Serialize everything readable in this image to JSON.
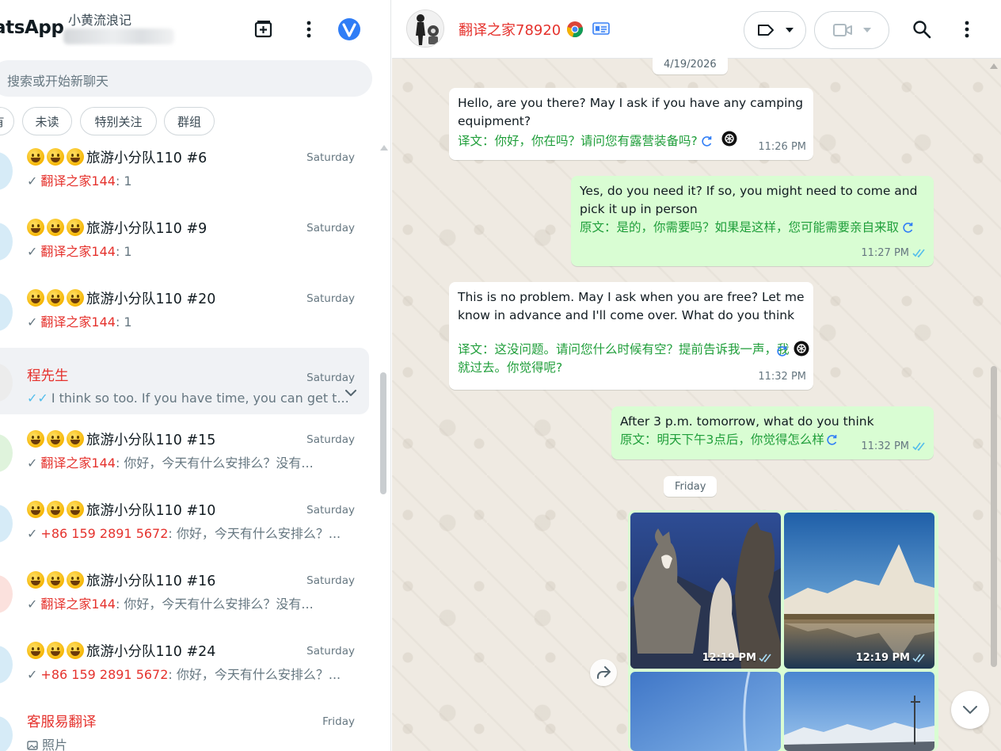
{
  "app": {
    "brand": "atsApp",
    "account_name": "小黄流浪记"
  },
  "search": {
    "placeholder": "搜索或开始新聊天"
  },
  "filters": [
    "有",
    "未读",
    "特别关注",
    "群组"
  ],
  "chats": [
    {
      "name": "旅游小分队110 #6",
      "emoji_prefix": 3,
      "time": "Saturday",
      "tick": "✓",
      "sender": "翻译之家144",
      "preview": ": 1",
      "avatar_color": "#d6ebf7"
    },
    {
      "name": "旅游小分队110 #9",
      "emoji_prefix": 3,
      "time": "Saturday",
      "tick": "✓",
      "sender": "翻译之家144",
      "preview": ": 1",
      "avatar_color": "#d6ebf7"
    },
    {
      "name": "旅游小分队110 #20",
      "emoji_prefix": 3,
      "time": "Saturday",
      "tick": "✓",
      "sender": "翻译之家144",
      "preview": ": 1",
      "avatar_color": "#d6ebf7"
    },
    {
      "name": "程先生",
      "emoji_prefix": 0,
      "time": "Saturday",
      "tick": "✓✓",
      "sender": "",
      "preview": "I think so too. If you have time, you can get t...",
      "avatar_color": "#ececec"
    },
    {
      "name": "旅游小分队110 #15",
      "emoji_prefix": 3,
      "time": "Saturday",
      "tick": "✓",
      "sender": "翻译之家144",
      "preview": ": 你好，今天有什么安排么？没有...",
      "avatar_color": "#dff3dc"
    },
    {
      "name": "旅游小分队110 #10",
      "emoji_prefix": 3,
      "time": "Saturday",
      "tick": "✓",
      "sender": "+86 159 2891 5672",
      "preview": ": 你好，今天有什么安排么？...",
      "avatar_color": "#d6ebf7"
    },
    {
      "name": "旅游小分队110 #16",
      "emoji_prefix": 3,
      "time": "Saturday",
      "tick": "✓",
      "sender": "翻译之家144",
      "preview": ": 你好，今天有什么安排么？没有...",
      "avatar_color": "#fbe1dd"
    },
    {
      "name": "旅游小分队110 #24",
      "emoji_prefix": 3,
      "time": "Saturday",
      "tick": "✓",
      "sender": "+86 159 2891 5672",
      "preview": ": 你好，今天有什么安排么？...",
      "avatar_color": "#d6ebf7"
    },
    {
      "name": "客服易翻译",
      "emoji_prefix": 0,
      "time": "Friday",
      "tick": "",
      "sender": "",
      "preview": "照片",
      "avatar_color": "#d6ebf7"
    }
  ],
  "conversation": {
    "contact_name": "翻译之家78920",
    "dates": {
      "first": "4/19/2026",
      "second": "Friday"
    },
    "messages": [
      {
        "dir": "in",
        "text": "Hello, are you there? May I ask if you have any camping equipment?",
        "translation": "译文：你好，你在吗？请问您有露营装备吗?",
        "time": "11:26 PM"
      },
      {
        "dir": "out",
        "text": "Yes, do you need it? If so, you might need to come and pick it up in person",
        "translation": "原文：是的，你需要吗？如果是这样，您可能需要亲自来取",
        "time": "11:27 PM"
      },
      {
        "dir": "in",
        "text": "This is no problem. May I ask when you are free? Let me know in advance and I'll come over. What do you think",
        "translation": "译文：这没问题。请问您什么时候有空？提前告诉我一声，我就过去。你觉得呢?",
        "time": "11:32 PM"
      },
      {
        "dir": "out",
        "text": "After 3 p.m. tomorrow, what do you think",
        "translation": "原文：明天下午3点后，你觉得怎么样",
        "time": "11:32 PM"
      }
    ],
    "photos": [
      {
        "subject": "llamas",
        "time": "12:19 PM"
      },
      {
        "subject": "mountain-lake",
        "time": "12:19 PM"
      },
      {
        "subject": "sky",
        "time": ""
      },
      {
        "subject": "snowy-road",
        "time": ""
      }
    ]
  },
  "colors": {
    "accent_red": "#e5322d",
    "translation_green": "#1f9e3a",
    "out_bubble": "#d9fdd3",
    "chat_bg": "#efeae2",
    "read_tick": "#53bdeb"
  }
}
